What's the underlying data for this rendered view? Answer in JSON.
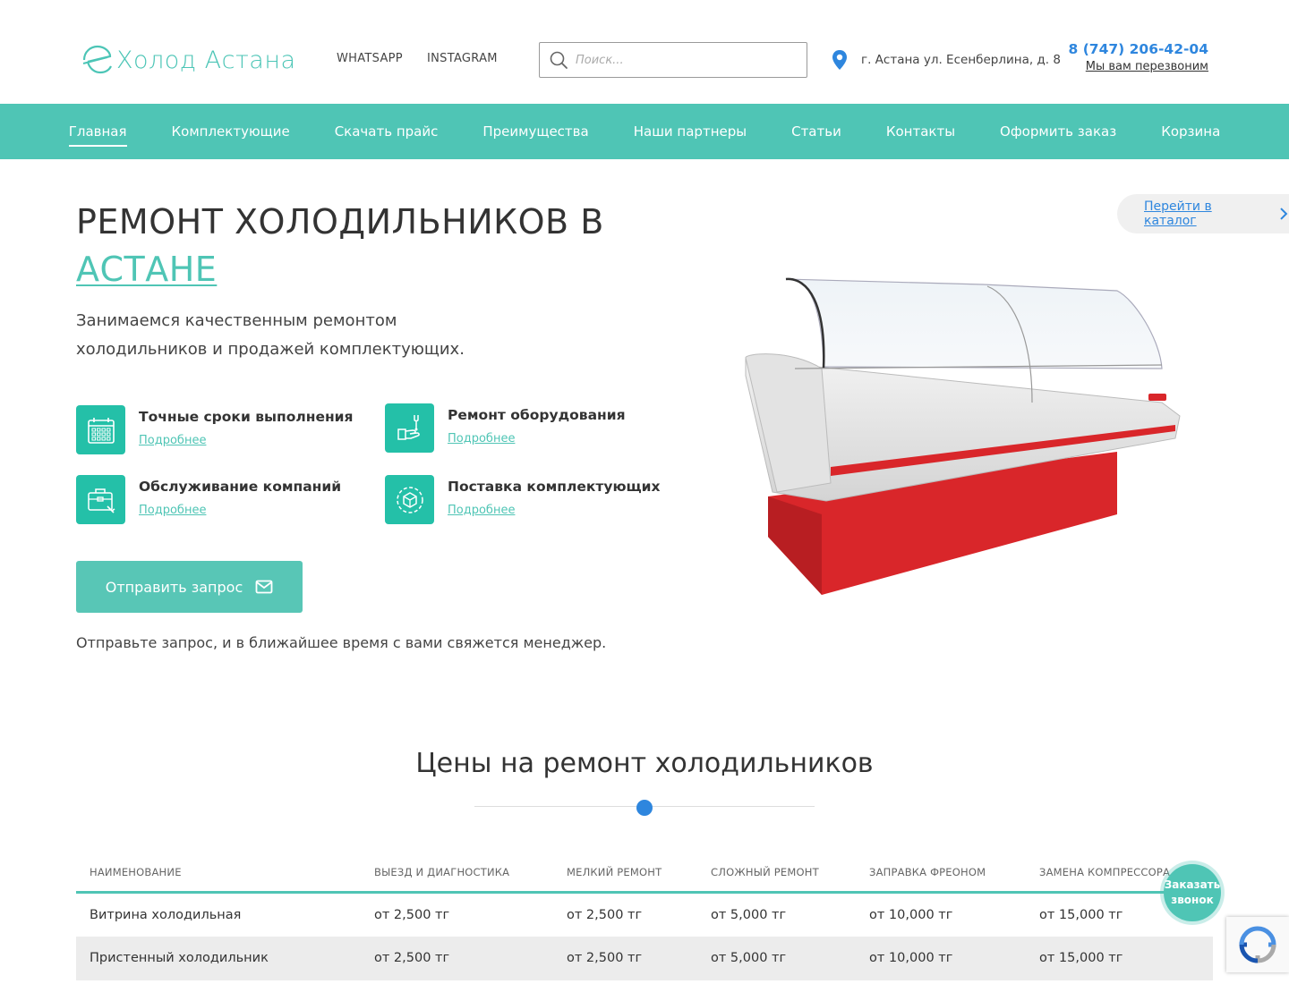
{
  "header": {
    "logo_text": "Холод Астана",
    "social": {
      "whatsapp": "WHATSAPP",
      "instagram": "INSTAGRAM"
    },
    "search_placeholder": "Поиск...",
    "address": "г. Астана ул. Есенберлина, д. 8",
    "phone": "8 (747) 206-42-04",
    "callback": "Мы вам перезвоним"
  },
  "nav": {
    "items": [
      {
        "label": "Главная"
      },
      {
        "label": "Комплектующие"
      },
      {
        "label": "Скачать прайс"
      },
      {
        "label": "Преимущества"
      },
      {
        "label": "Наши партнеры"
      },
      {
        "label": "Статьи"
      },
      {
        "label": "Контакты"
      },
      {
        "label": "Оформить заказ"
      },
      {
        "label": "Корзина"
      }
    ],
    "active_index": 0
  },
  "hero": {
    "title_line1": "РЕМОНТ ХОЛОДИЛЬНИКОВ В",
    "title_accent": "АСТАНЕ",
    "description": "Занимаемся качественным ремонтом холодильников и продажей комплектующих.",
    "features": [
      {
        "title": "Точные сроки выполнения",
        "link": "Подробнее",
        "icon": "calendar-icon"
      },
      {
        "title": "Ремонт оборудования",
        "link": "Подробнее",
        "icon": "repair-hand-icon"
      },
      {
        "title": "Обслуживание компаний",
        "link": "Подробнее",
        "icon": "toolbox-icon"
      },
      {
        "title": "Поставка комплектующих",
        "link": "Подробнее",
        "icon": "gear-box-icon"
      }
    ],
    "send_button": "Отправить запрос",
    "send_note": "Отправьте запрос, и в ближайшее время с вами свяжется менеджер.",
    "catalog_link": "Перейти в каталог"
  },
  "prices": {
    "title": "Цены на ремонт холодильников",
    "columns": [
      "Наименование",
      "Выезд и диагностика",
      "Мелкий ремонт",
      "Сложный ремонт",
      "Заправка фреоном",
      "Замена компрессора"
    ],
    "rows": [
      [
        "Витрина холодильная",
        "от 2,500 тг",
        "от 2,500 тг",
        "от 5,000 тг",
        "от 10,000 тг",
        "от 15,000 тг"
      ],
      [
        "Пристенный холодильник",
        "от 2,500 тг",
        "от 2,500 тг",
        "от 5,000 тг",
        "от 10,000 тг",
        "от 15,000 тг"
      ]
    ]
  },
  "order_call": {
    "line1": "Заказать",
    "line2": "звонок"
  },
  "colors": {
    "accent": "#4fc5b5",
    "link_blue": "#2e86de",
    "fridge_red": "#d9262a"
  }
}
